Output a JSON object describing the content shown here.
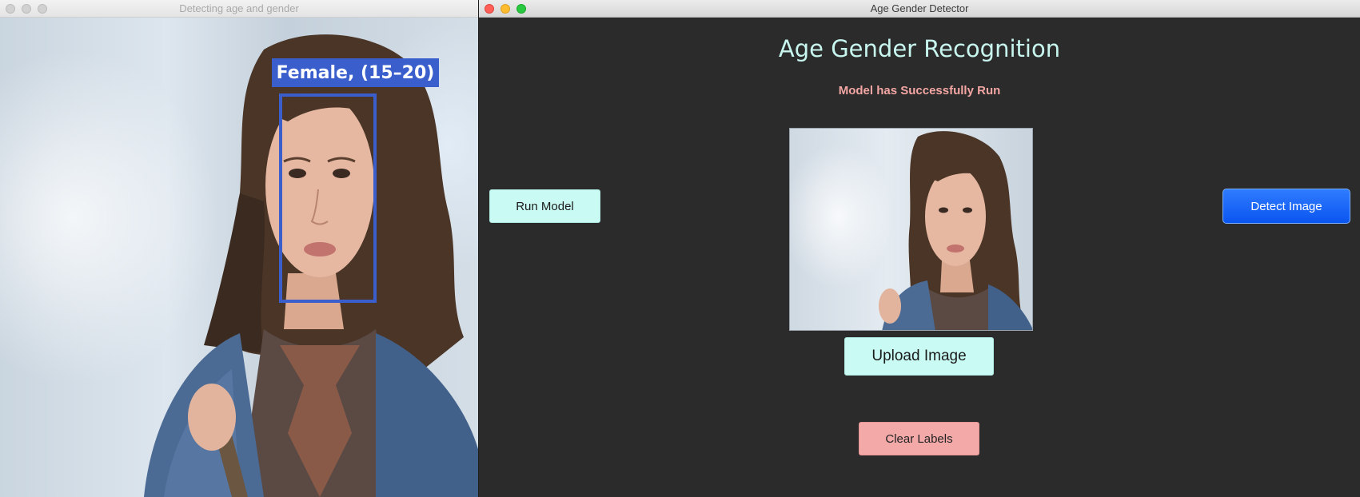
{
  "left_window": {
    "title": "Detecting age and gender",
    "detection_label": "Female, (15–20)",
    "box_color": "#3a5fcd"
  },
  "right_window": {
    "title": "Age Gender Detector",
    "heading": "Age Gender Recognition",
    "status": "Model has Successfully Run",
    "buttons": {
      "run_model": "Run Model",
      "detect_image": "Detect Image",
      "upload_image": "Upload Image",
      "clear_labels": "Clear Labels"
    },
    "colors": {
      "heading": "#c8f6ef",
      "status": "#f3a6a3",
      "background": "#2b2b2b",
      "accent_blue": "#0b55f0"
    }
  }
}
